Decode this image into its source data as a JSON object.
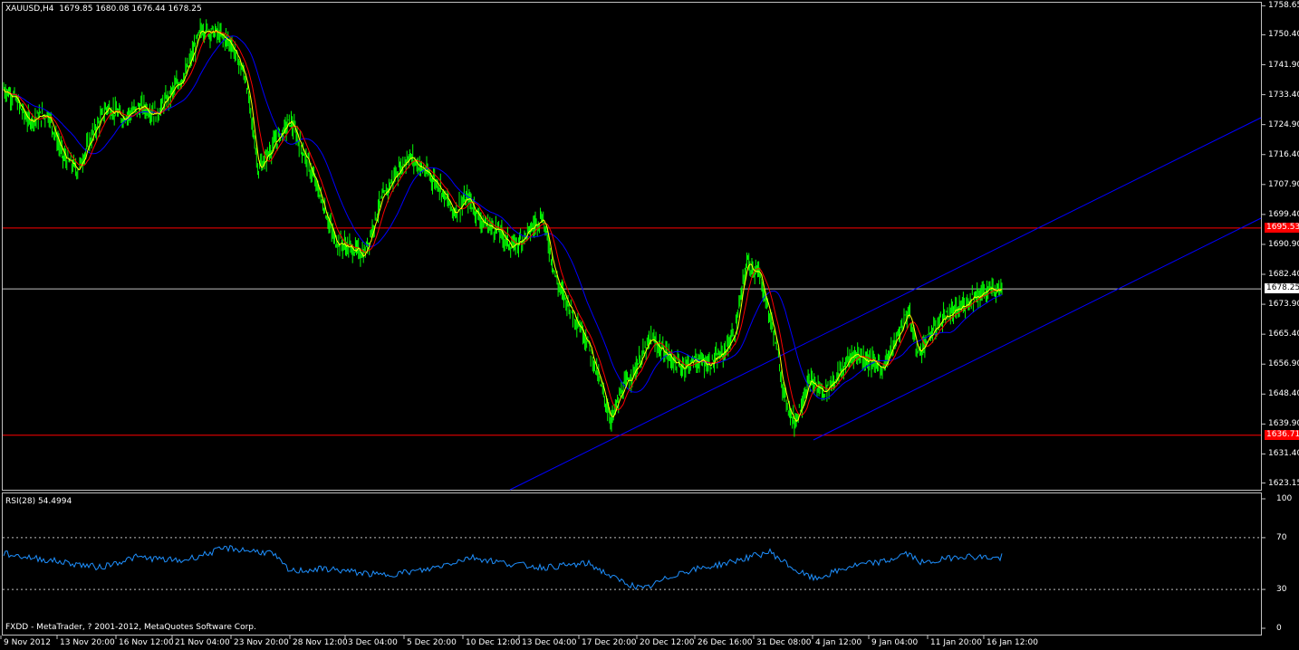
{
  "header": {
    "symbol": "XAUUSD,H4",
    "ohlc": "1679.85 1680.08 1676.44 1678.25"
  },
  "indicator": {
    "label": "RSI(28) 54.4994"
  },
  "footer": {
    "copyright": "FXDD - MetaTrader, ? 2001-2012, MetaQuotes Software Corp."
  },
  "price_axis": {
    "ticks": [
      "1758.65",
      "1750.40",
      "1741.90",
      "1733.40",
      "1724.90",
      "1716.40",
      "1707.90",
      "1699.40",
      "1690.90",
      "1682.40",
      "1673.90",
      "1665.40",
      "1656.90",
      "1648.40",
      "1639.90",
      "1631.40",
      "1623.15"
    ],
    "levels": [
      {
        "value": "1695.53",
        "color": "#ff0000"
      },
      {
        "value": "1678.25",
        "color": "#ffffff"
      },
      {
        "value": "1636.71",
        "color": "#ff0000"
      }
    ]
  },
  "rsi_axis": {
    "ticks": [
      "100",
      "70",
      "30",
      "0"
    ]
  },
  "time_axis": {
    "ticks": [
      "9 Nov 2012",
      "13 Nov 20:00",
      "16 Nov 12:00",
      "21 Nov 04:00",
      "23 Nov 20:00",
      "28 Nov 12:00",
      "3 Dec 04:00",
      "5 Dec 20:00",
      "10 Dec 12:00",
      "13 Dec 04:00",
      "17 Dec 20:00",
      "20 Dec 12:00",
      "26 Dec 16:00",
      "31 Dec 08:00",
      "4 Jan 12:00",
      "9 Jan 04:00",
      "11 Jan 20:00",
      "16 Jan 12:00"
    ]
  },
  "colors": {
    "background": "#000000",
    "candles": "#00ff00",
    "ma_fast": "#ffff00",
    "ma_mid": "#ff0000",
    "ma_slow": "#0000ff",
    "channel": "#0000ff",
    "rsi": "#1e90ff",
    "support_resistance": "#ff0000",
    "current_price_line": "#c0c0c0"
  }
}
